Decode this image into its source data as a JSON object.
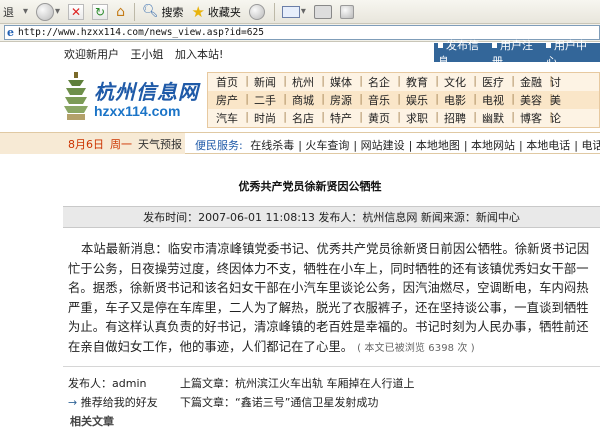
{
  "browser": {
    "back_label": "退",
    "toolbar": {
      "search_label": "搜索",
      "favorites_label": "收藏夹"
    },
    "address": "http://www.hzxx114.com/news_view.asp?id=625"
  },
  "site": {
    "welcome": [
      "欢迎新用户",
      "王小姐",
      "加入本站!"
    ],
    "user_links": [
      "发布信息",
      "用户注册",
      "用户中心"
    ],
    "logo_cn": "杭州信息网",
    "logo_url": "hzxx114.com",
    "nav_rows": [
      [
        "首页",
        "新闻",
        "杭州",
        "媒体",
        "名企",
        "教育",
        "文化",
        "医疗",
        "金融",
        "讨"
      ],
      [
        "房产",
        "二手",
        "商城",
        "房源",
        "音乐",
        "娱乐",
        "电影",
        "电视",
        "美容",
        "美"
      ],
      [
        "汽车",
        "时尚",
        "名店",
        "特产",
        "黄页",
        "求职",
        "招聘",
        "幽默",
        "博客",
        "论"
      ]
    ],
    "date": "8月6日",
    "weekday": "周一",
    "weather": "天气预报",
    "services_label": "便民服务:",
    "services": [
      "在线杀毒",
      "火车查询",
      "网站建设",
      "本地地图",
      "本地网站",
      "本地电话",
      "电话"
    ]
  },
  "article": {
    "title": "优秀共产党员徐新贤因公牺牲",
    "meta": "发布时间：2007-06-01 11:08:13 发布人：杭州信息网 新闻来源：新闻中心",
    "body": "本站最新消息：临安市清凉峰镇党委书记、优秀共产党员徐新贤日前因公牺牲。徐新贤书记因忙于公务，日夜操劳过度，终因体力不支，牺牲在小车上，同时牺牲的还有该镇优秀妇女干部一名。据悉，徐新贤书记和该名妇女干部在小汽车里谈论公务，因汽油燃尽，空调断电，车内闷热严重，车子又是停在车库里，二人为了解热，脱光了衣服裤子，还在坚持谈公事，一直谈到牺牲为止。有这样认真负责的好书记，清凉峰镇的老百姓是幸福的。书记时刻为人民办事，牺牲前还在亲自做妇女工作，他的事迹，人们都记在了心里。",
    "views": "( 本文已被浏览 6398 次 )",
    "poster": "发布人：admin",
    "recommend": "推荐给我的好友",
    "prev": "上篇文章：杭州滨江火车出轨 车厢掉在人行道上",
    "next": "下篇文章：“鑫诺三号”通信卫星发射成功",
    "bottom_hint": "相关文章"
  }
}
